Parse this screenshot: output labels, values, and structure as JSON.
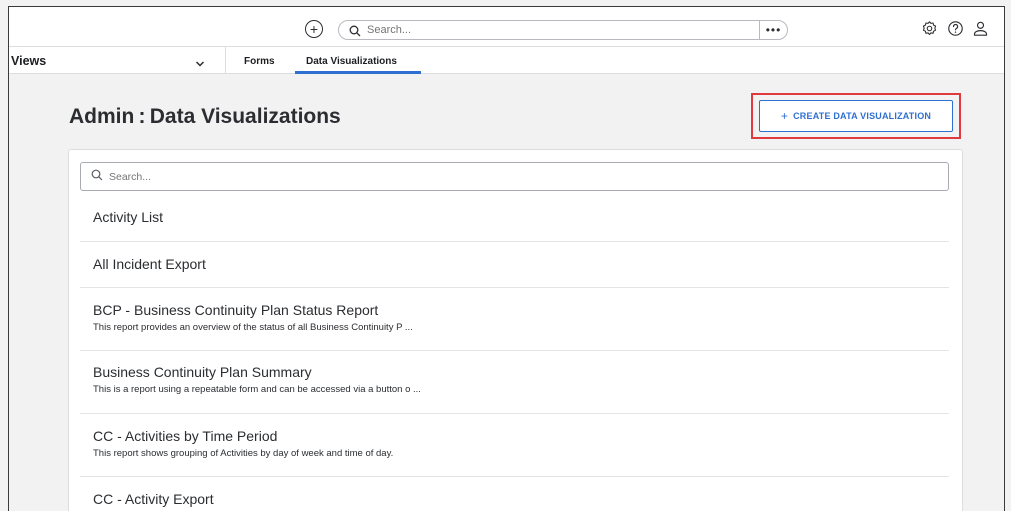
{
  "topbar": {
    "search_placeholder": "Search...",
    "more_label": "•••"
  },
  "navbar": {
    "views_label": "Views",
    "tabs": [
      {
        "label": "Forms"
      },
      {
        "label": "Data Visualizations",
        "active": true
      }
    ]
  },
  "page": {
    "title": "Admin : Data Visualizations",
    "create_button_label": "CREATE DATA VISUALIZATION",
    "search_placeholder": "Search..."
  },
  "items": [
    {
      "name": "Activity List",
      "description": ""
    },
    {
      "name": "All Incident Export",
      "description": ""
    },
    {
      "name": "BCP - Business Continuity Plan Status Report",
      "description": "This report provides an overview of the status of all Business Continuity P ..."
    },
    {
      "name": "Business Continuity Plan Summary",
      "description": "This is a report using a repeatable form and can be accessed via a button o ..."
    },
    {
      "name": "CC - Activities by Time Period",
      "description": "This report shows grouping of Activities by day of week and time of day."
    },
    {
      "name": "CC - Activity Export",
      "description": ""
    }
  ],
  "colors": {
    "accent": "#2f6fd0",
    "highlight": "#e0393e",
    "background": "#f2f2f3"
  },
  "icons": [
    "add-icon",
    "search-icon",
    "more-icon",
    "settings-icon",
    "help-icon",
    "user-icon",
    "chevron-down-icon"
  ]
}
